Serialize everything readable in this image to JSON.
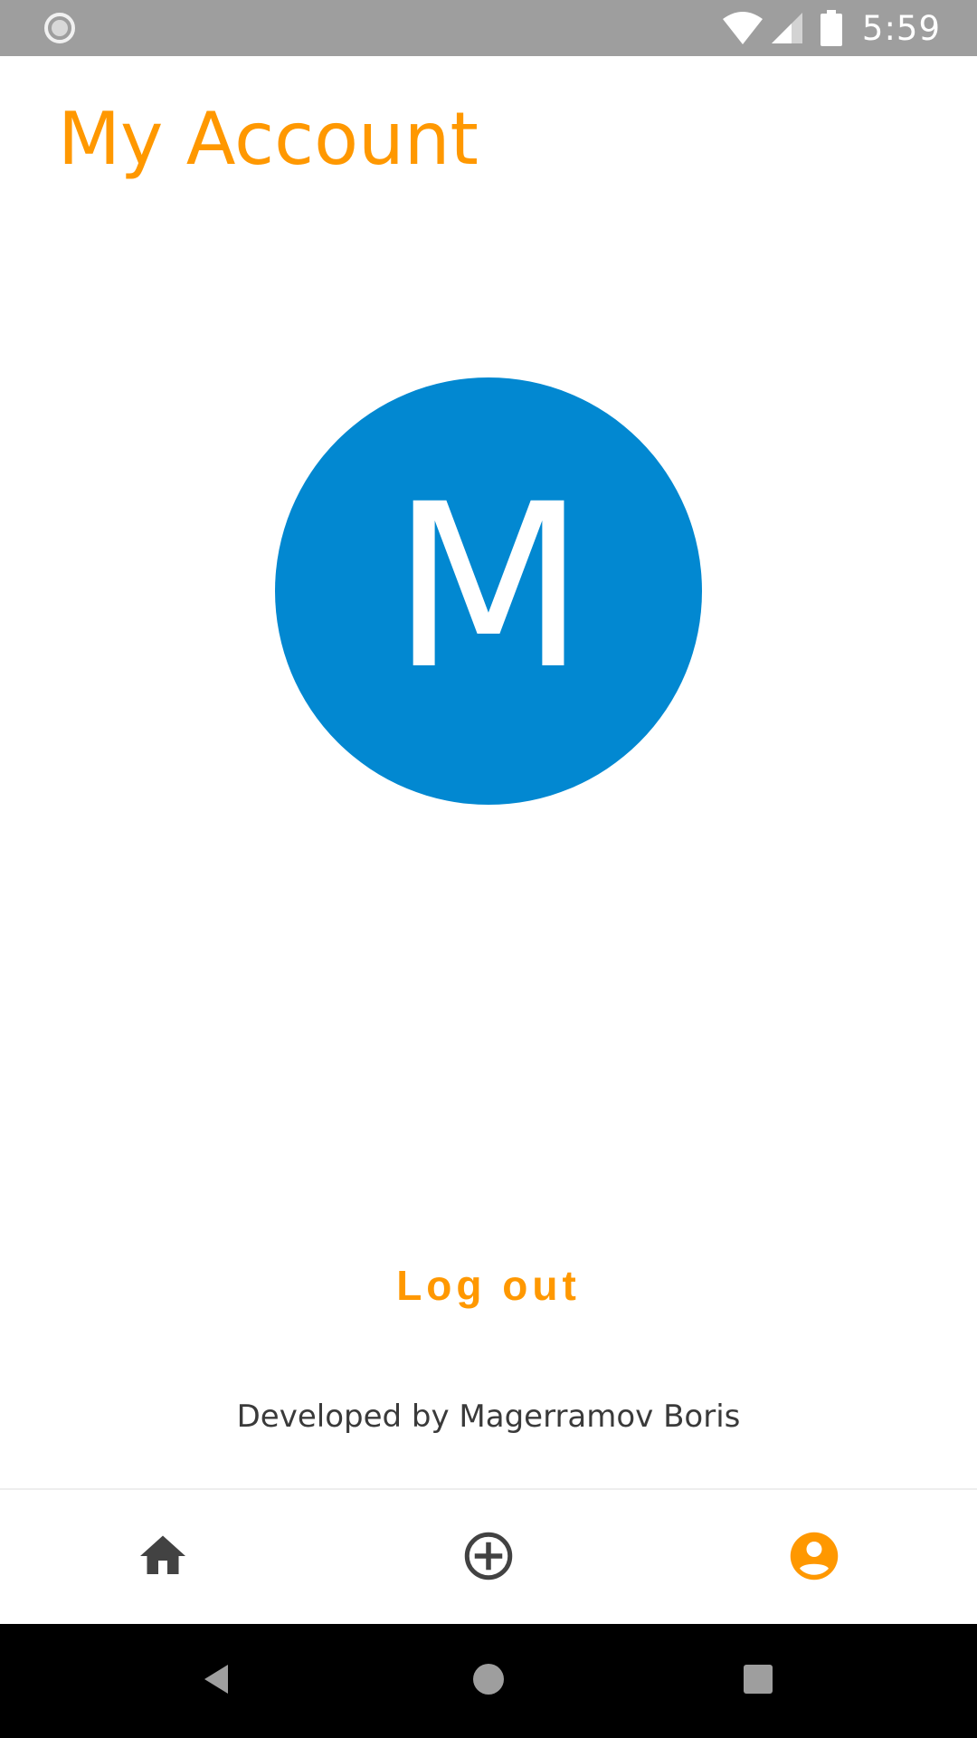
{
  "status_bar": {
    "time": "5:59",
    "icons": [
      "loading-icon",
      "wifi-icon",
      "signal-icon",
      "battery-icon"
    ]
  },
  "page": {
    "title": "My Account"
  },
  "avatar": {
    "initial": "M",
    "color": "#0288d1"
  },
  "actions": {
    "logout_label": "Log out"
  },
  "footer": {
    "credit": "Developed by Magerramov Boris"
  },
  "bottom_nav": {
    "items": [
      {
        "icon": "home-icon",
        "active": false
      },
      {
        "icon": "add-circle-icon",
        "active": false
      },
      {
        "icon": "account-circle-icon",
        "active": true
      }
    ]
  },
  "system_nav": {
    "icons": [
      "back-icon",
      "home-circle-icon",
      "recents-icon"
    ]
  },
  "colors": {
    "accent": "#ff9800",
    "avatar": "#0288d1",
    "status_bar": "#9e9e9e",
    "inactive_icon": "#424242"
  }
}
